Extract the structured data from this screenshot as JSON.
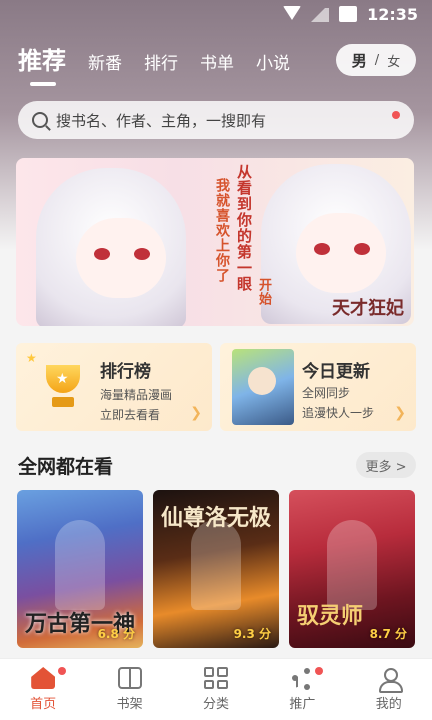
{
  "status_bar": {
    "time": "12:35"
  },
  "nav": {
    "tabs": [
      {
        "label": "推荐",
        "active": true
      },
      {
        "label": "新番"
      },
      {
        "label": "排行"
      },
      {
        "label": "书单"
      },
      {
        "label": "小说"
      }
    ],
    "gender": {
      "male": "男",
      "separator": "/",
      "female": "女",
      "selected": "男"
    }
  },
  "search": {
    "placeholder": "搜书名、作者、主角，一搜即有"
  },
  "banner": {
    "text_1": "我就喜欢上你了",
    "text_2": "从看到你的第一眼",
    "text_3": "开始",
    "logo": "天才狂妃"
  },
  "cards": {
    "ranking": {
      "title": "排行榜",
      "sub1": "海量精品漫画",
      "sub2": "立即去看看"
    },
    "update": {
      "title": "今日更新",
      "sub1": "全网同步",
      "sub2": "追漫快人一步"
    }
  },
  "section": {
    "title": "全网都在看",
    "more_label": "更多 >",
    "comics": [
      {
        "title_art": "万古第一神",
        "score": "6.8 分"
      },
      {
        "title_art": "仙尊洛无极",
        "score": "9.3 分"
      },
      {
        "title_art": "驭灵师",
        "score": "8.7 分"
      }
    ]
  },
  "bottom_nav": {
    "items": [
      {
        "label": "首页",
        "icon": "home-icon",
        "active": true,
        "dot": true
      },
      {
        "label": "书架",
        "icon": "bookshelf-icon"
      },
      {
        "label": "分类",
        "icon": "category-icon"
      },
      {
        "label": "推广",
        "icon": "share-icon",
        "dot": true
      },
      {
        "label": "我的",
        "icon": "profile-icon"
      }
    ]
  },
  "colors": {
    "accent": "#e35336",
    "badge": "#f05454",
    "score": "#ffcf45"
  }
}
